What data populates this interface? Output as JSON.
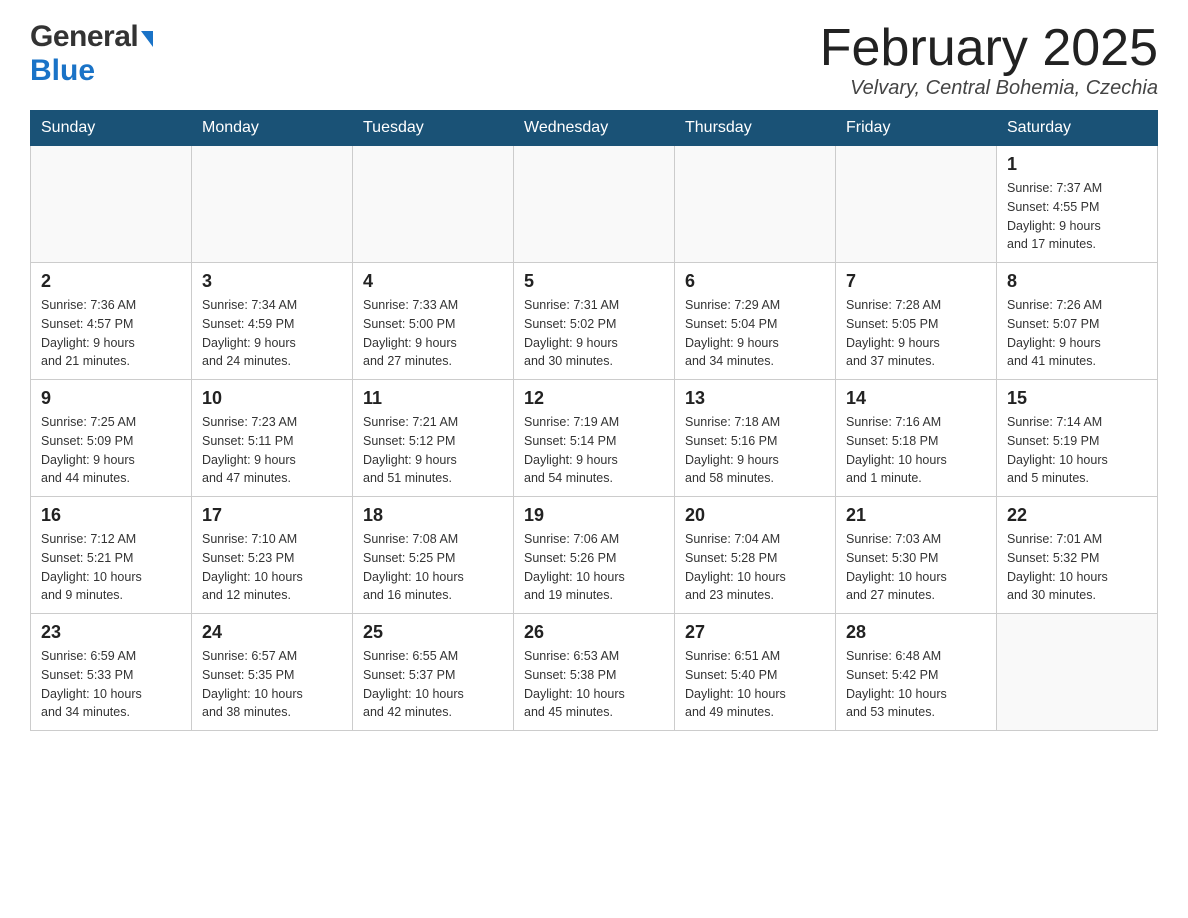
{
  "header": {
    "logo_general": "General",
    "logo_blue": "Blue",
    "month_title": "February 2025",
    "location": "Velvary, Central Bohemia, Czechia"
  },
  "calendar": {
    "days_of_week": [
      "Sunday",
      "Monday",
      "Tuesday",
      "Wednesday",
      "Thursday",
      "Friday",
      "Saturday"
    ],
    "weeks": [
      [
        {
          "day": "",
          "info": ""
        },
        {
          "day": "",
          "info": ""
        },
        {
          "day": "",
          "info": ""
        },
        {
          "day": "",
          "info": ""
        },
        {
          "day": "",
          "info": ""
        },
        {
          "day": "",
          "info": ""
        },
        {
          "day": "1",
          "info": "Sunrise: 7:37 AM\nSunset: 4:55 PM\nDaylight: 9 hours\nand 17 minutes."
        }
      ],
      [
        {
          "day": "2",
          "info": "Sunrise: 7:36 AM\nSunset: 4:57 PM\nDaylight: 9 hours\nand 21 minutes."
        },
        {
          "day": "3",
          "info": "Sunrise: 7:34 AM\nSunset: 4:59 PM\nDaylight: 9 hours\nand 24 minutes."
        },
        {
          "day": "4",
          "info": "Sunrise: 7:33 AM\nSunset: 5:00 PM\nDaylight: 9 hours\nand 27 minutes."
        },
        {
          "day": "5",
          "info": "Sunrise: 7:31 AM\nSunset: 5:02 PM\nDaylight: 9 hours\nand 30 minutes."
        },
        {
          "day": "6",
          "info": "Sunrise: 7:29 AM\nSunset: 5:04 PM\nDaylight: 9 hours\nand 34 minutes."
        },
        {
          "day": "7",
          "info": "Sunrise: 7:28 AM\nSunset: 5:05 PM\nDaylight: 9 hours\nand 37 minutes."
        },
        {
          "day": "8",
          "info": "Sunrise: 7:26 AM\nSunset: 5:07 PM\nDaylight: 9 hours\nand 41 minutes."
        }
      ],
      [
        {
          "day": "9",
          "info": "Sunrise: 7:25 AM\nSunset: 5:09 PM\nDaylight: 9 hours\nand 44 minutes."
        },
        {
          "day": "10",
          "info": "Sunrise: 7:23 AM\nSunset: 5:11 PM\nDaylight: 9 hours\nand 47 minutes."
        },
        {
          "day": "11",
          "info": "Sunrise: 7:21 AM\nSunset: 5:12 PM\nDaylight: 9 hours\nand 51 minutes."
        },
        {
          "day": "12",
          "info": "Sunrise: 7:19 AM\nSunset: 5:14 PM\nDaylight: 9 hours\nand 54 minutes."
        },
        {
          "day": "13",
          "info": "Sunrise: 7:18 AM\nSunset: 5:16 PM\nDaylight: 9 hours\nand 58 minutes."
        },
        {
          "day": "14",
          "info": "Sunrise: 7:16 AM\nSunset: 5:18 PM\nDaylight: 10 hours\nand 1 minute."
        },
        {
          "day": "15",
          "info": "Sunrise: 7:14 AM\nSunset: 5:19 PM\nDaylight: 10 hours\nand 5 minutes."
        }
      ],
      [
        {
          "day": "16",
          "info": "Sunrise: 7:12 AM\nSunset: 5:21 PM\nDaylight: 10 hours\nand 9 minutes."
        },
        {
          "day": "17",
          "info": "Sunrise: 7:10 AM\nSunset: 5:23 PM\nDaylight: 10 hours\nand 12 minutes."
        },
        {
          "day": "18",
          "info": "Sunrise: 7:08 AM\nSunset: 5:25 PM\nDaylight: 10 hours\nand 16 minutes."
        },
        {
          "day": "19",
          "info": "Sunrise: 7:06 AM\nSunset: 5:26 PM\nDaylight: 10 hours\nand 19 minutes."
        },
        {
          "day": "20",
          "info": "Sunrise: 7:04 AM\nSunset: 5:28 PM\nDaylight: 10 hours\nand 23 minutes."
        },
        {
          "day": "21",
          "info": "Sunrise: 7:03 AM\nSunset: 5:30 PM\nDaylight: 10 hours\nand 27 minutes."
        },
        {
          "day": "22",
          "info": "Sunrise: 7:01 AM\nSunset: 5:32 PM\nDaylight: 10 hours\nand 30 minutes."
        }
      ],
      [
        {
          "day": "23",
          "info": "Sunrise: 6:59 AM\nSunset: 5:33 PM\nDaylight: 10 hours\nand 34 minutes."
        },
        {
          "day": "24",
          "info": "Sunrise: 6:57 AM\nSunset: 5:35 PM\nDaylight: 10 hours\nand 38 minutes."
        },
        {
          "day": "25",
          "info": "Sunrise: 6:55 AM\nSunset: 5:37 PM\nDaylight: 10 hours\nand 42 minutes."
        },
        {
          "day": "26",
          "info": "Sunrise: 6:53 AM\nSunset: 5:38 PM\nDaylight: 10 hours\nand 45 minutes."
        },
        {
          "day": "27",
          "info": "Sunrise: 6:51 AM\nSunset: 5:40 PM\nDaylight: 10 hours\nand 49 minutes."
        },
        {
          "day": "28",
          "info": "Sunrise: 6:48 AM\nSunset: 5:42 PM\nDaylight: 10 hours\nand 53 minutes."
        },
        {
          "day": "",
          "info": ""
        }
      ]
    ]
  }
}
